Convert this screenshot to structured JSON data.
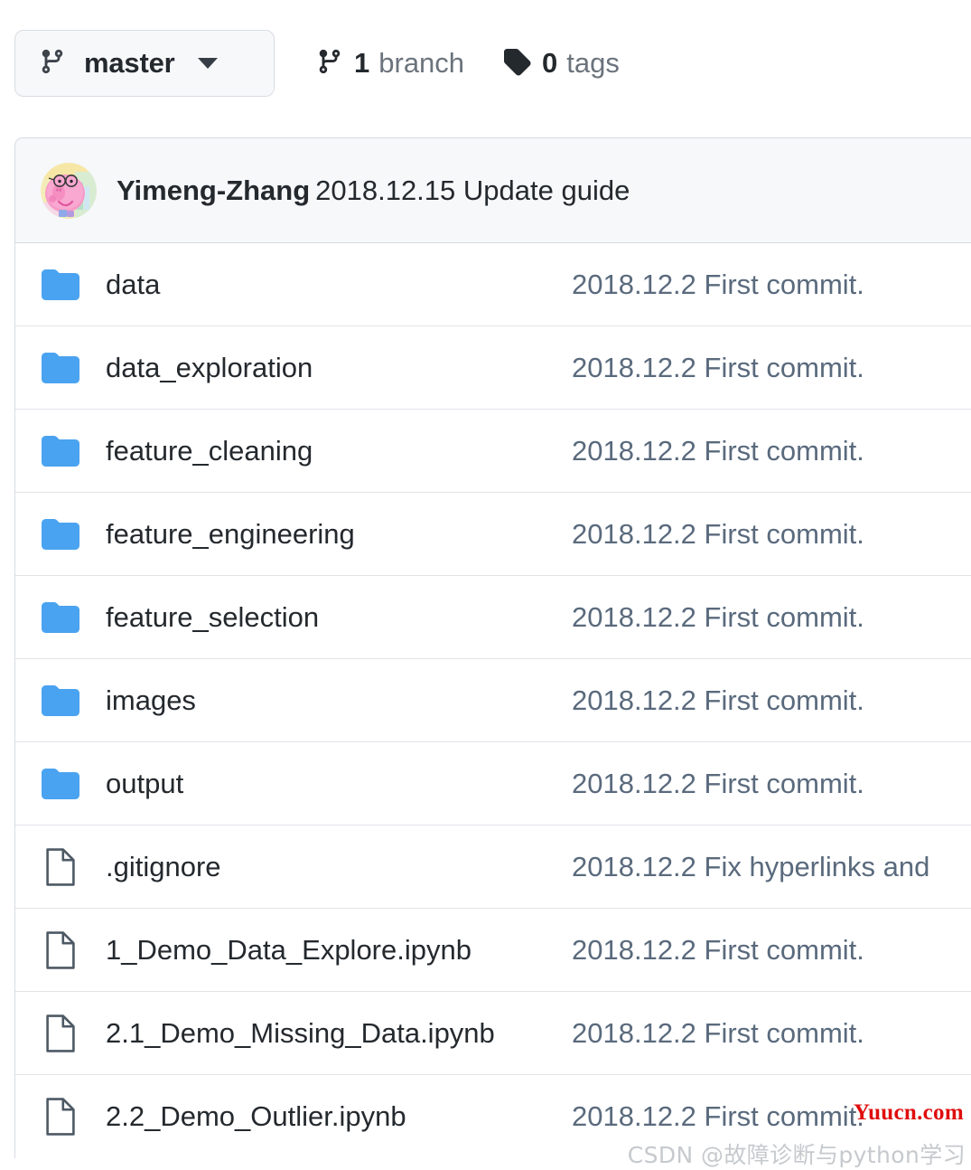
{
  "toolbar": {
    "branch_button": {
      "label": "master",
      "icon": "git-branch-icon",
      "chevron": "chevron-down-icon"
    },
    "branches": {
      "count": "1",
      "word": "branch",
      "icon": "git-branch-icon"
    },
    "tags": {
      "count": "0",
      "word": "tags",
      "icon": "tag-icon"
    }
  },
  "commit_header": {
    "avatar": "user-avatar-peppa-pig",
    "author": "Yimeng-Zhang",
    "message": "2018.12.15 Update guide"
  },
  "files": [
    {
      "type": "folder",
      "name": "data",
      "commit": "2018.12.2 First commit."
    },
    {
      "type": "folder",
      "name": "data_exploration",
      "commit": "2018.12.2 First commit."
    },
    {
      "type": "folder",
      "name": "feature_cleaning",
      "commit": "2018.12.2 First commit."
    },
    {
      "type": "folder",
      "name": "feature_engineering",
      "commit": "2018.12.2 First commit."
    },
    {
      "type": "folder",
      "name": "feature_selection",
      "commit": "2018.12.2 First commit."
    },
    {
      "type": "folder",
      "name": "images",
      "commit": "2018.12.2 First commit."
    },
    {
      "type": "folder",
      "name": "output",
      "commit": "2018.12.2 First commit."
    },
    {
      "type": "file",
      "name": ".gitignore",
      "commit": "2018.12.2 Fix hyperlinks and"
    },
    {
      "type": "file",
      "name": "1_Demo_Data_Explore.ipynb",
      "commit": "2018.12.2 First commit."
    },
    {
      "type": "file",
      "name": "2.1_Demo_Missing_Data.ipynb",
      "commit": "2018.12.2 First commit."
    },
    {
      "type": "file",
      "name": "2.2_Demo_Outlier.ipynb",
      "commit": "2018.12.2 First commit."
    }
  ],
  "watermarks": {
    "yuucn": "Yuucn.com",
    "csdn": "CSDN @故障诊断与python学习"
  },
  "colors": {
    "folder_icon": "#4aa3f0",
    "file_icon": "#4d5965",
    "commit_text": "#5a6a7d",
    "name_text": "#24292e",
    "header_bg": "#f6f8fa",
    "border": "#d6dae0",
    "row_divider": "#e1e4e8",
    "watermark_red": "#e00d0d",
    "watermark_gray": "#c6c9cd"
  }
}
